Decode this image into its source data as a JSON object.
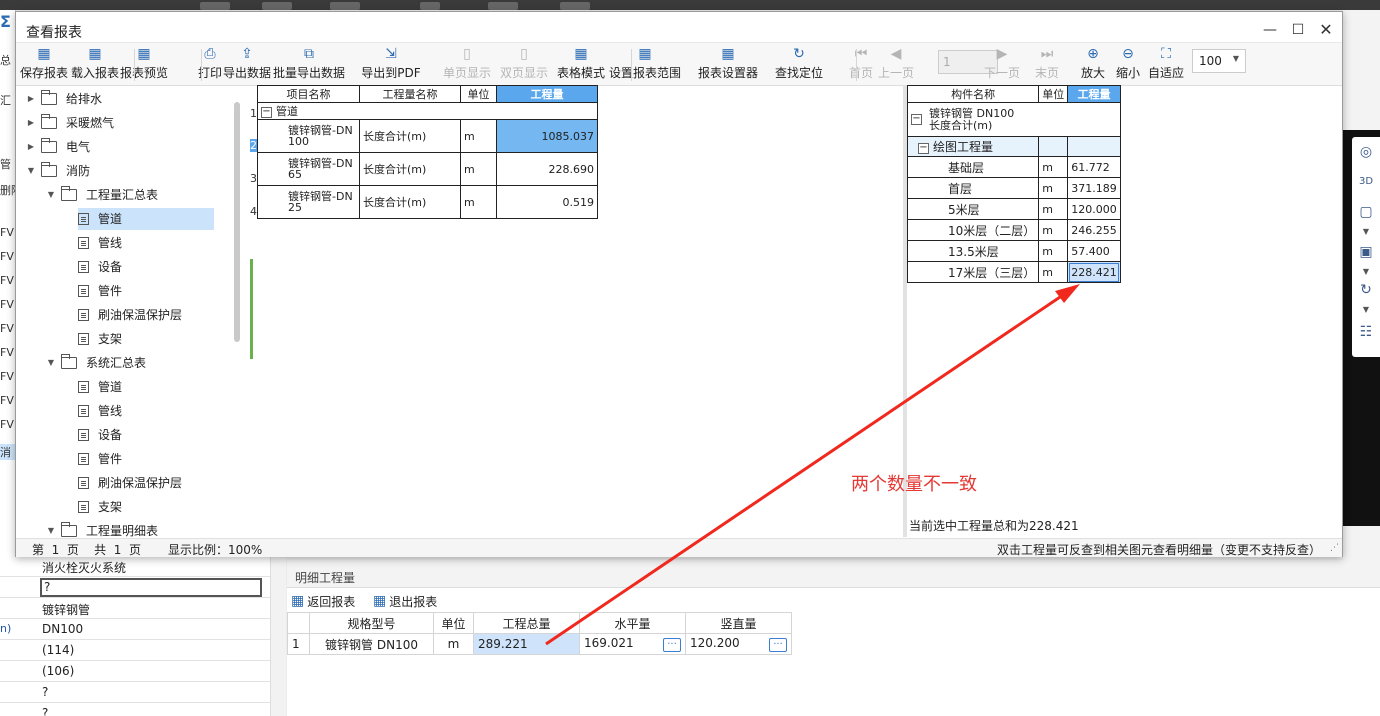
{
  "bg": {
    "left_labels": [
      "总",
      "汇",
      "管",
      "删除",
      "FV",
      "FV",
      "FV",
      "FV",
      "FV",
      "FV",
      "FV",
      "FV",
      "FV",
      "消"
    ],
    "sigma": "Σ",
    "props": [
      {
        "key": "",
        "val": "消火栓灭火系统"
      },
      {
        "key": "",
        "val": "?"
      },
      {
        "key": "",
        "val": "镀锌钢管"
      },
      {
        "key": "n)",
        "val": "DN100"
      },
      {
        "key": "",
        "val": "(114)"
      },
      {
        "key": "",
        "val": "(106)"
      },
      {
        "key": "",
        "val": "?"
      },
      {
        "key": "",
        "val": "?"
      }
    ]
  },
  "dialog": {
    "title": "查看报表",
    "toolbar": [
      {
        "label": "保存报表",
        "icon": "table-icon",
        "glyph": "▦",
        "enabled": true
      },
      {
        "label": "载入报表",
        "icon": "load-table-icon",
        "glyph": "▦",
        "enabled": true
      },
      {
        "label": "报表预览",
        "icon": "preview-table-icon",
        "glyph": "▦",
        "enabled": true
      },
      {
        "label": "打印",
        "icon": "print-icon",
        "glyph": "⎙",
        "enabled": true
      },
      {
        "label": "导出数据",
        "icon": "export-data-icon",
        "glyph": "⇪",
        "enabled": true
      },
      {
        "label": "批量导出数据",
        "icon": "batch-export-icon",
        "glyph": "⧉",
        "enabled": true
      },
      {
        "label": "导出到PDF",
        "icon": "export-pdf-icon",
        "glyph": "⇲",
        "enabled": true
      },
      {
        "label": "单页显示",
        "icon": "single-page-icon",
        "glyph": "▯",
        "enabled": false
      },
      {
        "label": "双页显示",
        "icon": "double-page-icon",
        "glyph": "▯",
        "enabled": false
      },
      {
        "label": "表格模式",
        "icon": "grid-mode-icon",
        "glyph": "▦",
        "enabled": true
      },
      {
        "label": "设置报表范围",
        "icon": "range-icon",
        "glyph": "▦",
        "enabled": true
      },
      {
        "label": "报表设置器",
        "icon": "settings-table-icon",
        "glyph": "▦",
        "enabled": true
      },
      {
        "label": "查找定位",
        "icon": "locate-icon",
        "glyph": "↻",
        "enabled": true
      },
      {
        "label": "首页",
        "icon": "first-page-icon",
        "glyph": "⏮",
        "enabled": false
      },
      {
        "label": "上一页",
        "icon": "prev-page-icon",
        "glyph": "◀",
        "enabled": false
      },
      {
        "label": "下一页",
        "icon": "next-page-icon",
        "glyph": "▶",
        "enabled": false
      },
      {
        "label": "末页",
        "icon": "last-page-icon",
        "glyph": "⏭",
        "enabled": false
      },
      {
        "label": "放大",
        "icon": "zoom-in-icon",
        "glyph": "⊕",
        "enabled": true
      },
      {
        "label": "缩小",
        "icon": "zoom-out-icon",
        "glyph": "⊖",
        "enabled": true
      },
      {
        "label": "自适应",
        "icon": "fit-icon",
        "glyph": "⛶",
        "enabled": true
      }
    ],
    "page_input": "1",
    "zoom_value": "100",
    "tree": [
      {
        "label": "给排水",
        "type": "folder",
        "level": 0,
        "expanded": false
      },
      {
        "label": "采暖燃气",
        "type": "folder",
        "level": 0,
        "expanded": false
      },
      {
        "label": "电气",
        "type": "folder",
        "level": 0,
        "expanded": false
      },
      {
        "label": "消防",
        "type": "folder",
        "level": 0,
        "expanded": true
      },
      {
        "label": "工程量汇总表",
        "type": "folder",
        "level": 1,
        "expanded": true
      },
      {
        "label": "管道",
        "type": "doc",
        "level": 2,
        "selected": true
      },
      {
        "label": "管线",
        "type": "doc",
        "level": 2
      },
      {
        "label": "设备",
        "type": "doc",
        "level": 2
      },
      {
        "label": "管件",
        "type": "doc",
        "level": 2
      },
      {
        "label": "刷油保温保护层",
        "type": "doc",
        "level": 2
      },
      {
        "label": "支架",
        "type": "doc",
        "level": 2
      },
      {
        "label": "系统汇总表",
        "type": "folder",
        "level": 1,
        "expanded": true
      },
      {
        "label": "管道",
        "type": "doc",
        "level": 2
      },
      {
        "label": "管线",
        "type": "doc",
        "level": 2
      },
      {
        "label": "设备",
        "type": "doc",
        "level": 2
      },
      {
        "label": "管件",
        "type": "doc",
        "level": 2
      },
      {
        "label": "刷油保温保护层",
        "type": "doc",
        "level": 2
      },
      {
        "label": "支架",
        "type": "doc",
        "level": 2
      },
      {
        "label": "工程量明细表",
        "type": "folder",
        "level": 1,
        "expanded": true
      }
    ],
    "report": {
      "headers": [
        "项目名称",
        "工程量名称",
        "单位",
        "工程量"
      ],
      "group": "管道",
      "rows": [
        {
          "no": "2",
          "name1": "镀锌钢管-DN",
          "name2": "100",
          "qname": "长度合计(m)",
          "unit": "m",
          "value": "1085.037"
        },
        {
          "no": "3",
          "name1": "镀锌钢管-DN",
          "name2": "65",
          "qname": "长度合计(m)",
          "unit": "m",
          "value": "228.690"
        },
        {
          "no": "4",
          "name1": "镀锌钢管-DN",
          "name2": "25",
          "qname": "长度合计(m)",
          "unit": "m",
          "value": "0.519"
        }
      ],
      "first_no": "1"
    },
    "detail_report": {
      "headers": [
        "构件名称",
        "单位",
        "工程量"
      ],
      "comp_line1": "镀锌钢管 DN100",
      "comp_line2": "长度合计(m)",
      "sub_group": "绘图工程量",
      "rows": [
        {
          "floor": "基础层",
          "unit": "m",
          "value": "61.772"
        },
        {
          "floor": "首层",
          "unit": "m",
          "value": "371.189"
        },
        {
          "floor": "5米层",
          "unit": "m",
          "value": "120.000"
        },
        {
          "floor": "10米层（二层）",
          "unit": "m",
          "value": "246.255"
        },
        {
          "floor": "13.5米层",
          "unit": "m",
          "value": "57.400"
        },
        {
          "floor": "17米层（三层）",
          "unit": "m",
          "value": "228.421"
        }
      ]
    },
    "selection_sum": "当前选中工程量总和为228.421",
    "status": {
      "page_info": "第  1  页    共  1  页",
      "scale": "显示比例：100%",
      "hint": "双击工程量可反查到相关图元查看明细量（变更不支持反查）"
    }
  },
  "detail_panel": {
    "title": "明细工程量",
    "back_btn": "返回报表",
    "exit_btn": "退出报表",
    "headers": [
      "规格型号",
      "单位",
      "工程总量",
      "水平量",
      "竖直量"
    ],
    "rows": [
      {
        "no": "1",
        "spec": "镀锌钢管 DN100",
        "unit": "m",
        "total": "289.221",
        "horizontal": "169.021",
        "vertical": "120.200"
      }
    ]
  },
  "annotation": {
    "text": "两个数量不一致",
    "color": "#e53935"
  }
}
